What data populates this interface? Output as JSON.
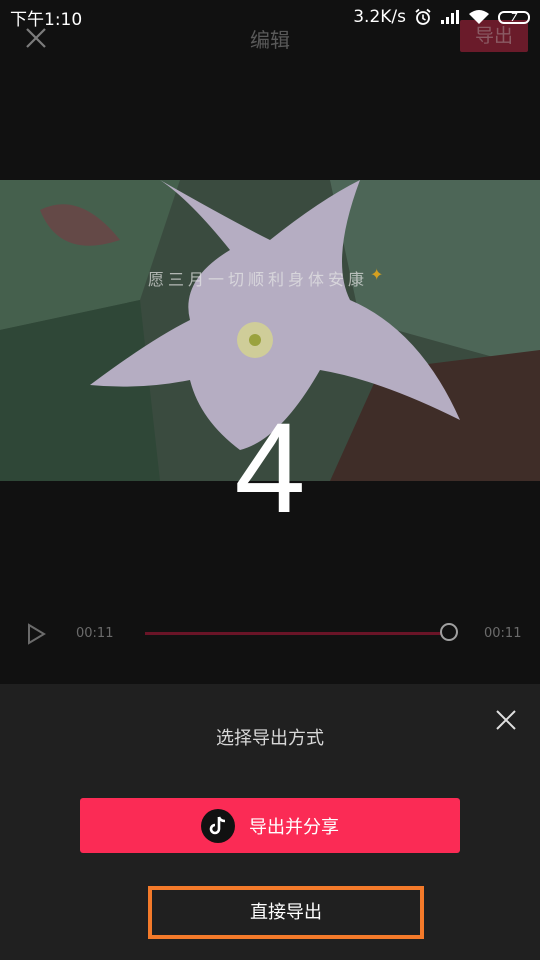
{
  "status_bar": {
    "time": "下午1:10",
    "network_speed": "3.2K/s",
    "battery": "7",
    "icons": [
      "alarm-icon",
      "signal-icon",
      "wifi-icon",
      "battery-icon"
    ]
  },
  "header": {
    "title": "编辑",
    "export_label": "导出"
  },
  "video": {
    "overlay_text": "愿三月一切顺利身体安康",
    "countdown": "4"
  },
  "playback": {
    "current_time": "00:11",
    "total_time": "00:11",
    "progress": 1.0
  },
  "sheet": {
    "title": "选择导出方式",
    "share_button_label": "导出并分享",
    "direct_export_label": "直接导出"
  },
  "colors": {
    "accent": "#fb2b55",
    "highlight_box": "#f47a2a"
  }
}
